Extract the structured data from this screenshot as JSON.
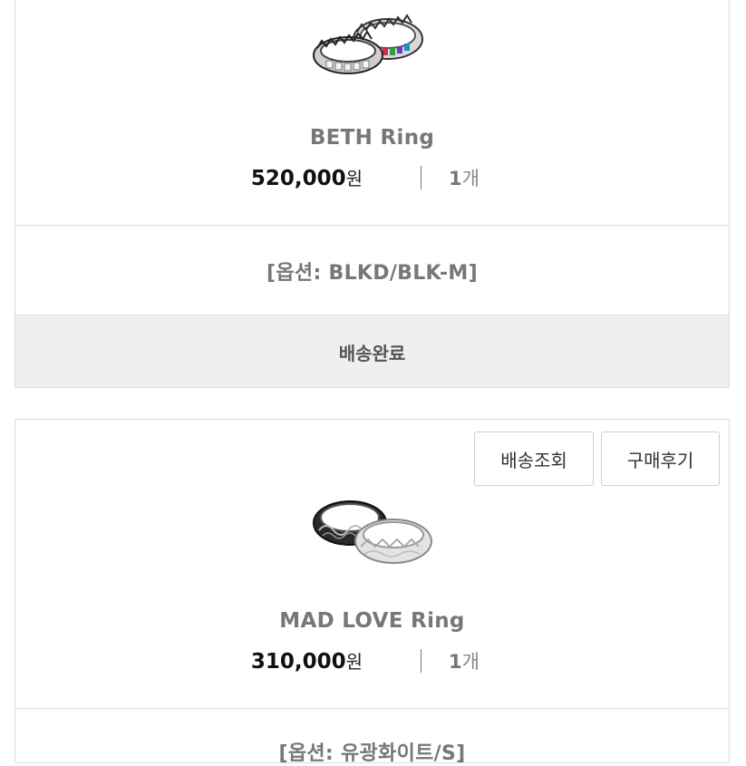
{
  "orders": [
    {
      "product_name": "BETH Ring",
      "price": "520,000",
      "currency": "원",
      "quantity": "1",
      "quantity_unit": "개",
      "option": "[옵션: BLKD/BLK-M]",
      "status": "배송완료"
    },
    {
      "buttons": {
        "track_label": "배송조회",
        "review_label": "구매후기"
      },
      "product_name": "MAD LOVE Ring",
      "price": "310,000",
      "currency": "원",
      "quantity": "1",
      "quantity_unit": "개",
      "option": "[옵션: 유광화이트/S]"
    }
  ]
}
